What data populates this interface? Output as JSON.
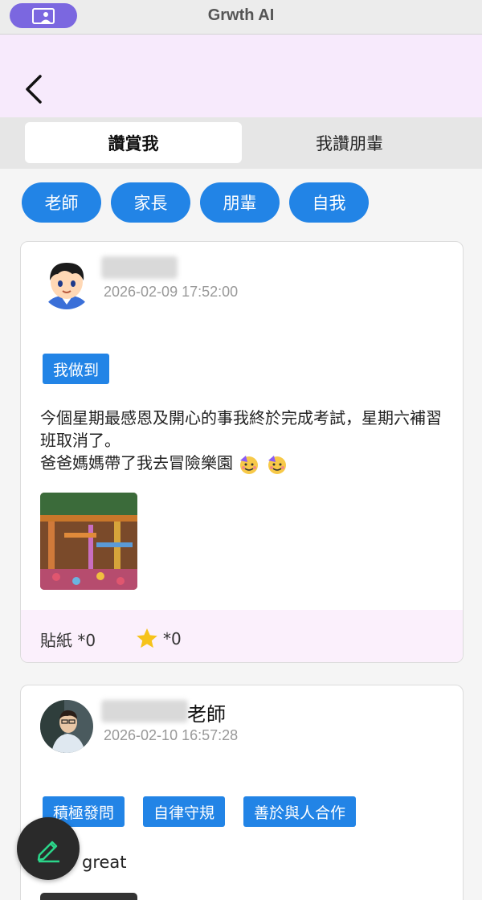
{
  "app": {
    "title": "Grwth AI"
  },
  "tabs": [
    {
      "label": "讚賞我",
      "active": true
    },
    {
      "label": "我讚朋輩",
      "active": false
    }
  ],
  "filters": [
    "老師",
    "家長",
    "朋輩",
    "自我"
  ],
  "posts": [
    {
      "author_suffix": "",
      "date": "2026-02-09 17:52:00",
      "tags": [
        "我做到"
      ],
      "content_line1": "今個星期最感恩及開心的事我終於完成考試，星期六補習班取消了。",
      "content_line2": "爸爸媽媽帶了我去冒險樂園",
      "stickers_label": "貼紙 *0",
      "stars_label": "*0"
    },
    {
      "author_suffix": "老師",
      "date": "2026-02-10 16:57:28",
      "tags": [
        "積極發問",
        "自律守規",
        "善於與人合作"
      ],
      "content": "great"
    }
  ],
  "colors": {
    "accent": "#2284e6",
    "header_bg": "#f7eafc",
    "titlebar_pill": "#7b67e0"
  },
  "icons": {
    "back": "chevron-left-icon",
    "compose": "pencil-icon",
    "star": "star-icon"
  }
}
